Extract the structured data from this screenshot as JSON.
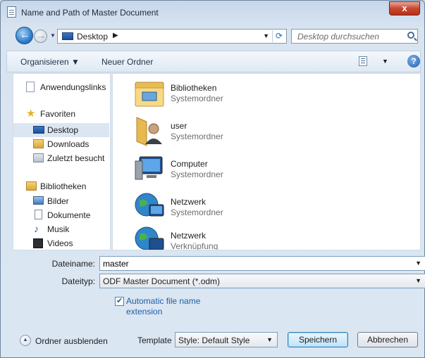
{
  "window": {
    "title": "Name and Path of Master Document",
    "close_label": "x"
  },
  "address": {
    "location": "Desktop",
    "search_placeholder": "Desktop durchsuchen"
  },
  "toolbar": {
    "organize_label": "Organisieren ▼",
    "new_folder_label": "Neuer Ordner"
  },
  "nav_pane": {
    "items": [
      {
        "label": "Anwendungslinks",
        "icon": "document-icon"
      },
      {
        "label": "Favoriten",
        "icon": "star-icon"
      },
      {
        "label": "Desktop",
        "icon": "desktop-icon",
        "selected": true
      },
      {
        "label": "Downloads",
        "icon": "downloads-folder-icon"
      },
      {
        "label": "Zuletzt besucht",
        "icon": "recent-places-icon"
      },
      {
        "label": "Bibliotheken",
        "icon": "libraries-icon"
      },
      {
        "label": "Bilder",
        "icon": "pictures-icon"
      },
      {
        "label": "Dokumente",
        "icon": "documents-icon"
      },
      {
        "label": "Musik",
        "icon": "music-icon"
      },
      {
        "label": "Videos",
        "icon": "videos-icon"
      }
    ]
  },
  "file_list": {
    "items": [
      {
        "name": "Bibliotheken",
        "type": "Systemordner",
        "icon": "libraries-folder-icon"
      },
      {
        "name": "user",
        "type": "Systemordner",
        "icon": "user-folder-icon"
      },
      {
        "name": "Computer",
        "type": "Systemordner",
        "icon": "computer-icon"
      },
      {
        "name": "Netzwerk",
        "type": "Systemordner",
        "icon": "network-icon"
      },
      {
        "name": "Netzwerk",
        "type": "Verknüpfung",
        "icon": "network-shortcut-icon"
      }
    ]
  },
  "form": {
    "filename_label": "Dateiname:",
    "filename_value": "master",
    "filetype_label": "Dateityp:",
    "filetype_value": "ODF Master Document (*.odm)",
    "auto_extension_label": "Automatic file name extension",
    "auto_extension_checked": true,
    "hide_folders_label": "Ordner ausblenden",
    "template_label": "Template",
    "template_value": "Style: Default Style",
    "save_label": "Speichern",
    "cancel_label": "Abbrechen"
  }
}
